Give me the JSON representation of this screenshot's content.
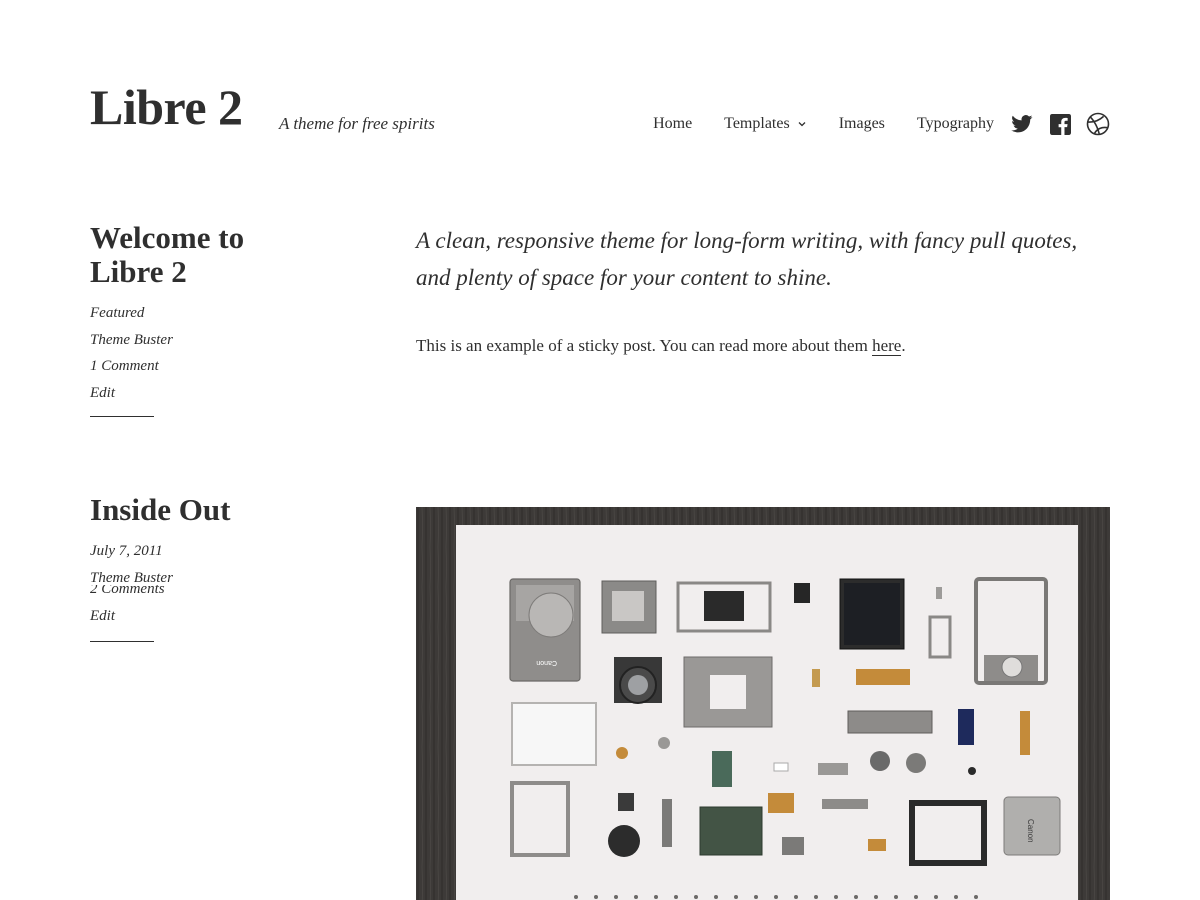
{
  "site": {
    "title": "Libre 2",
    "description": "A theme for free spirits"
  },
  "nav": {
    "items": [
      "Home",
      "Templates",
      "Images",
      "Typography"
    ],
    "social": [
      "twitter-icon",
      "facebook-icon",
      "dribbble-icon"
    ]
  },
  "posts": [
    {
      "title_line1": "Welcome to",
      "title_line2": "Libre 2",
      "meta": [
        "Featured",
        "Theme Buster",
        "1 Comment",
        "Edit"
      ],
      "lead": "A clean, responsive theme for long-form writing, with fancy pull quotes, and plenty of space for your content to shine.",
      "body_prefix": "This is an example of a sticky post. You can read more about them ",
      "body_link": "here",
      "body_suffix": "."
    },
    {
      "title": "Inside Out",
      "meta": [
        "July 7, 2011",
        "Theme Buster",
        "2 Comments",
        "Edit"
      ],
      "image": "disassembled-camera-photo",
      "image_labels": {
        "camera_brand": "Canon",
        "battery_brand": "Canon"
      }
    }
  ]
}
